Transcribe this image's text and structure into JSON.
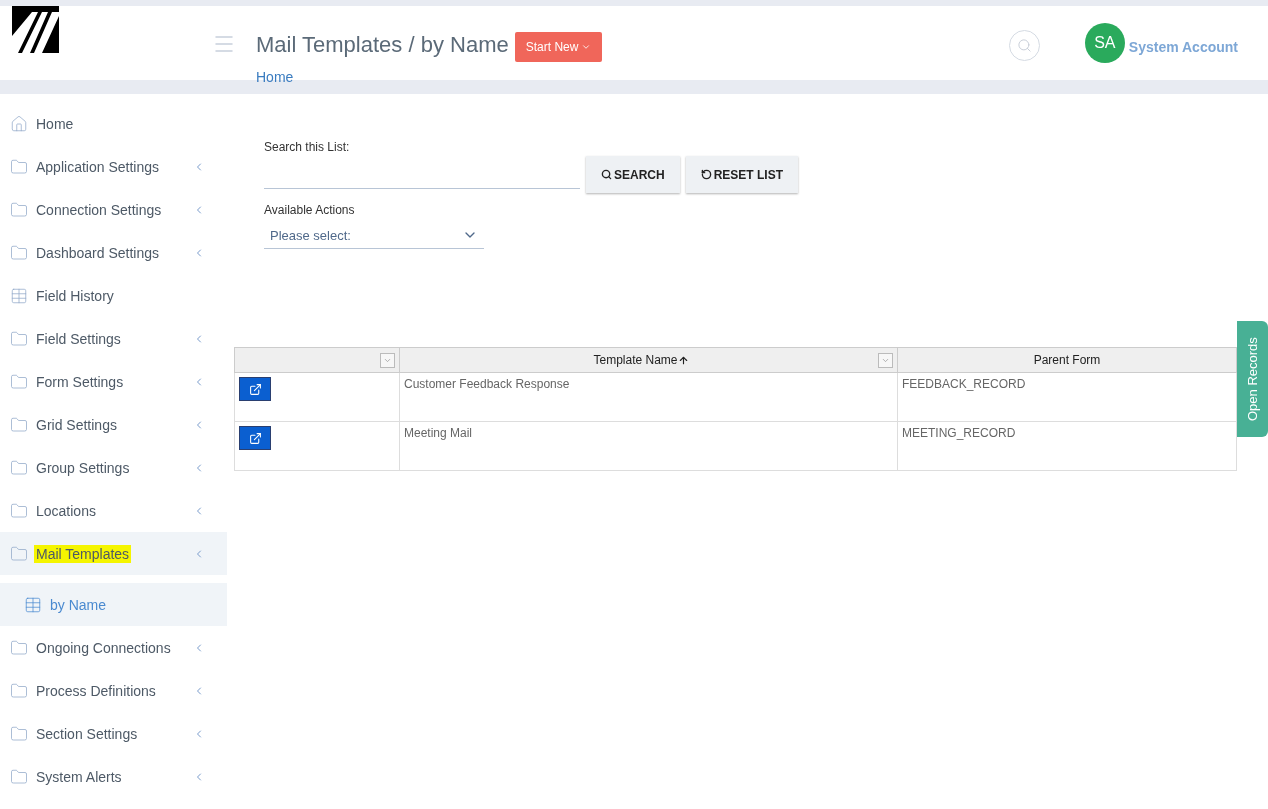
{
  "header": {
    "title": "Mail Templates / by Name",
    "start_button": "Start New",
    "breadcrumb": "Home",
    "avatar": "SA",
    "user": "System Account"
  },
  "sidebar": {
    "items": [
      {
        "kind": "home",
        "label": "Home",
        "selected": false,
        "highlighted": false,
        "has_children": false
      },
      {
        "kind": "folder",
        "label": "Application Settings",
        "selected": false,
        "highlighted": false,
        "has_children": true
      },
      {
        "kind": "folder",
        "label": "Connection Settings",
        "selected": false,
        "highlighted": false,
        "has_children": true
      },
      {
        "kind": "folder",
        "label": "Dashboard Settings",
        "selected": false,
        "highlighted": false,
        "has_children": true
      },
      {
        "kind": "grid",
        "label": "Field History",
        "selected": false,
        "highlighted": false,
        "has_children": false
      },
      {
        "kind": "folder",
        "label": "Field Settings",
        "selected": false,
        "highlighted": false,
        "has_children": true
      },
      {
        "kind": "folder",
        "label": "Form Settings",
        "selected": false,
        "highlighted": false,
        "has_children": true
      },
      {
        "kind": "folder",
        "label": "Grid Settings",
        "selected": false,
        "highlighted": false,
        "has_children": true
      },
      {
        "kind": "folder",
        "label": "Group Settings",
        "selected": false,
        "highlighted": false,
        "has_children": true
      },
      {
        "kind": "folder",
        "label": "Locations",
        "selected": false,
        "highlighted": false,
        "has_children": true
      },
      {
        "kind": "folder",
        "label": "Mail Templates",
        "selected": true,
        "highlighted": true,
        "has_children": true,
        "children": [
          {
            "kind": "grid",
            "label": "by Name",
            "selected": true,
            "highlighted": false,
            "has_children": false
          }
        ]
      },
      {
        "kind": "folder",
        "label": "Ongoing Connections",
        "selected": false,
        "highlighted": false,
        "has_children": true
      },
      {
        "kind": "folder",
        "label": "Process Definitions",
        "selected": false,
        "highlighted": false,
        "has_children": true
      },
      {
        "kind": "folder",
        "label": "Section Settings",
        "selected": false,
        "highlighted": false,
        "has_children": true
      },
      {
        "kind": "folder",
        "label": "System Alerts",
        "selected": false,
        "highlighted": false,
        "has_children": true
      }
    ]
  },
  "search": {
    "label": "Search this List:",
    "search_button": "SEARCH",
    "reset_button": "RESET LIST"
  },
  "actions": {
    "label": "Available Actions",
    "placeholder": "Please select:"
  },
  "table": {
    "columns": [
      {
        "filter": true
      },
      {
        "label": "Template Name",
        "filter": true,
        "sorted": true
      },
      {
        "label": "Parent Form"
      }
    ],
    "rows": [
      {
        "name": "Customer Feedback Response",
        "form": "FEEDBACK_RECORD"
      },
      {
        "name": "Meeting Mail",
        "form": "MEETING_RECORD"
      }
    ]
  },
  "side_tab": "Open Records"
}
